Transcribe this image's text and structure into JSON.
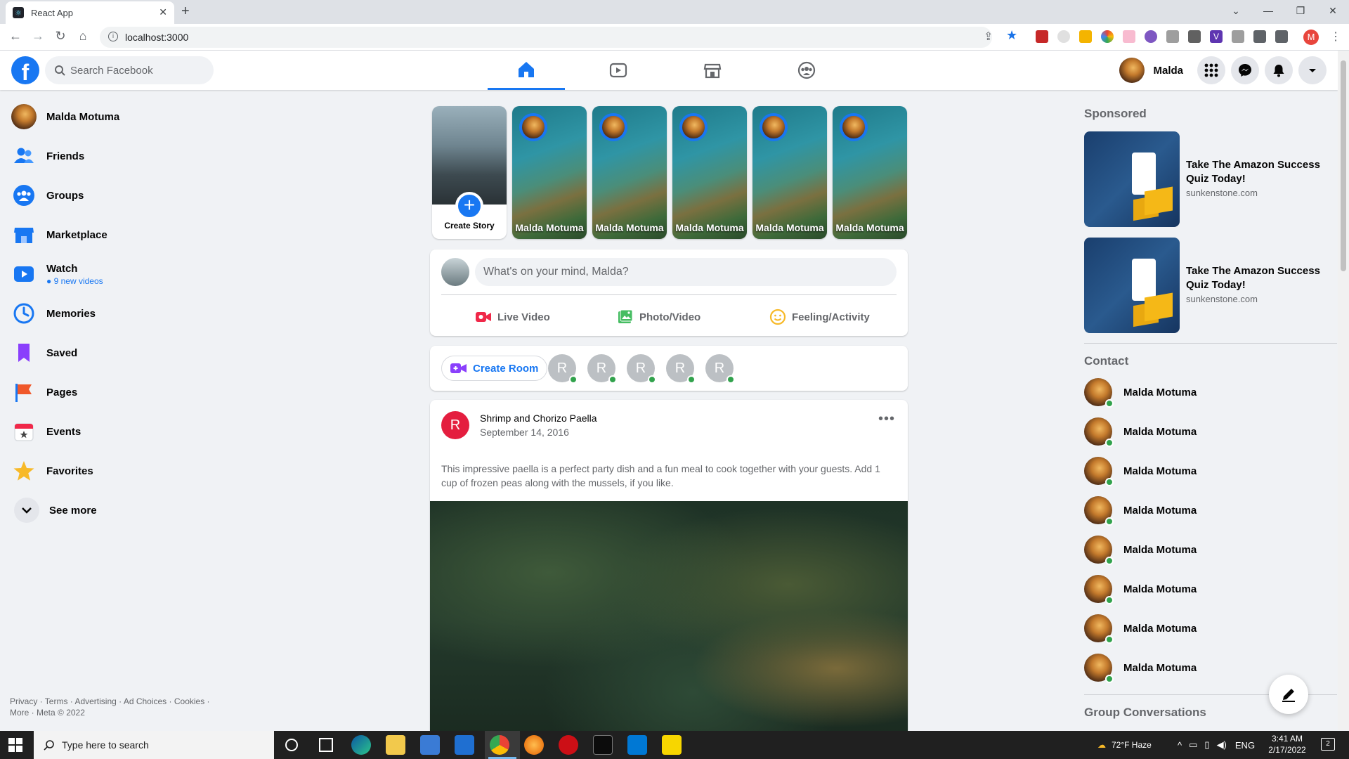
{
  "browser": {
    "tab_title": "React App",
    "url": "localhost:3000",
    "profile_initial": "M"
  },
  "header": {
    "search_placeholder": "Search Facebook",
    "user_name": "Malda"
  },
  "left_nav": {
    "user": "Malda Motuma",
    "items": [
      {
        "label": "Friends",
        "icon": "friends-icon"
      },
      {
        "label": "Groups",
        "icon": "groups-icon"
      },
      {
        "label": "Marketplace",
        "icon": "marketplace-icon"
      },
      {
        "label": "Watch",
        "icon": "watch-icon",
        "sub": "9 new videos"
      },
      {
        "label": "Memories",
        "icon": "memories-icon"
      },
      {
        "label": "Saved",
        "icon": "saved-icon"
      },
      {
        "label": "Pages",
        "icon": "pages-icon"
      },
      {
        "label": "Events",
        "icon": "events-icon"
      },
      {
        "label": "Favorites",
        "icon": "favorites-icon"
      }
    ],
    "see_more": "See more",
    "footer_line1": "Privacy · Terms · Advertising · Ad Choices · Cookies ·",
    "footer_line2": "More · Meta © 2022"
  },
  "stories": {
    "create_label": "Create Story",
    "items": [
      "Malda Motuma",
      "Malda Motuma",
      "Malda Motuma",
      "Malda Motuma",
      "Malda Motuma"
    ]
  },
  "composer": {
    "placeholder": "What's on your mind, Malda?",
    "live_video": "Live Video",
    "photo_video": "Photo/Video",
    "feeling": "Feeling/Activity"
  },
  "rooms": {
    "create_room": "Create Room",
    "avatars": [
      "R",
      "R",
      "R",
      "R",
      "R"
    ]
  },
  "post": {
    "avatar_initial": "R",
    "title": "Shrimp and Chorizo Paella",
    "date": "September 14, 2016",
    "more": "•••",
    "text": "This impressive paella is a perfect party dish and a fun meal to cook together with your guests. Add 1 cup of frozen peas along with the mussels, if you like."
  },
  "right": {
    "sponsored": "Sponsored",
    "ads": [
      {
        "title": "Take The Amazon Success Quiz Today!",
        "site": "sunkenstone.com"
      },
      {
        "title": "Take The Amazon Success Quiz Today!",
        "site": "sunkenstone.com"
      }
    ],
    "contact_heading": "Contact",
    "contacts": [
      "Malda Motuma",
      "Malda Motuma",
      "Malda Motuma",
      "Malda Motuma",
      "Malda Motuma",
      "Malda Motuma",
      "Malda Motuma",
      "Malda Motuma"
    ],
    "group_conversations": "Group Conversations"
  },
  "taskbar": {
    "search_placeholder": "Type here to search",
    "weather": "72°F  Haze",
    "lang": "ENG",
    "time": "3:41 AM",
    "date": "2/17/2022",
    "notifications": "2"
  },
  "colors": {
    "brand": "#1877f2",
    "online": "#31a24c"
  }
}
